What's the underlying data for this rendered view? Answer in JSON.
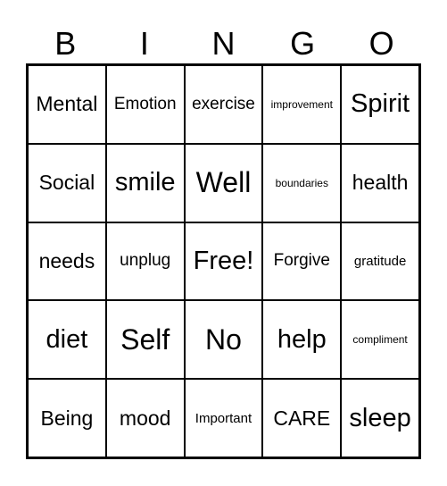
{
  "header": [
    "B",
    "I",
    "N",
    "G",
    "O"
  ],
  "cells": [
    {
      "text": "Mental",
      "size": "lg"
    },
    {
      "text": "Emotion",
      "size": "md"
    },
    {
      "text": "exercise",
      "size": "md"
    },
    {
      "text": "improvement",
      "size": "xs"
    },
    {
      "text": "Spirit",
      "size": "xl"
    },
    {
      "text": "Social",
      "size": "lg"
    },
    {
      "text": "smile",
      "size": "xl"
    },
    {
      "text": "Well",
      "size": "xxl"
    },
    {
      "text": "boundaries",
      "size": "xs"
    },
    {
      "text": "health",
      "size": "lg"
    },
    {
      "text": "needs",
      "size": "lg"
    },
    {
      "text": "unplug",
      "size": "md"
    },
    {
      "text": "Free!",
      "size": "xl"
    },
    {
      "text": "Forgive",
      "size": "md"
    },
    {
      "text": "gratitude",
      "size": "sm"
    },
    {
      "text": "diet",
      "size": "xl"
    },
    {
      "text": "Self",
      "size": "xxl"
    },
    {
      "text": "No",
      "size": "xxl"
    },
    {
      "text": "help",
      "size": "xl"
    },
    {
      "text": "compliment",
      "size": "xs"
    },
    {
      "text": "Being",
      "size": "lg"
    },
    {
      "text": "mood",
      "size": "lg"
    },
    {
      "text": "Important",
      "size": "sm"
    },
    {
      "text": "CARE",
      "size": "lg"
    },
    {
      "text": "sleep",
      "size": "xl"
    }
  ]
}
